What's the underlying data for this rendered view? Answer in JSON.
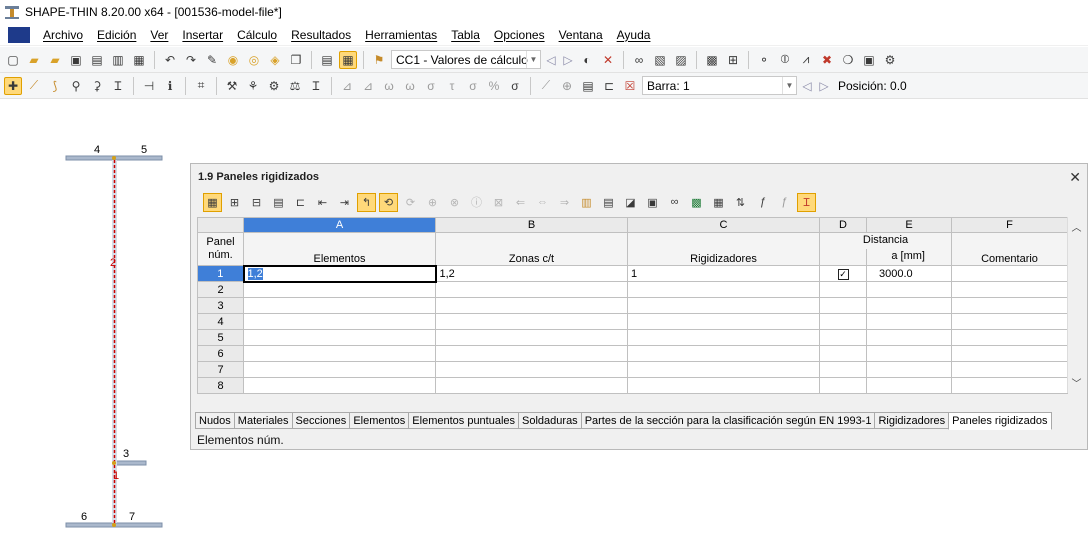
{
  "window": {
    "title": "SHAPE-THIN 8.20.00 x64 - [001536-model-file*]"
  },
  "menu": {
    "items": [
      "Archivo",
      "Edición",
      "Ver",
      "Insertar",
      "Cálculo",
      "Resultados",
      "Herramientas",
      "Tabla",
      "Opciones",
      "Ventana",
      "Ayuda"
    ]
  },
  "toolbar1": {
    "load_case": "CC1 - Valores de cálculo"
  },
  "toolbar2": {
    "bar_combo": "Barra: 1",
    "position": "Posición: 0.0"
  },
  "canvas": {
    "nodes": [
      "4",
      "5",
      "3",
      "6",
      "7"
    ],
    "elements": [
      "2",
      "1"
    ]
  },
  "panel": {
    "title": "1.9 Paneles rigidizados",
    "columns": [
      "A",
      "B",
      "C",
      "D",
      "E",
      "F"
    ],
    "header_group": "Distancia",
    "row_header_1": "Panel",
    "row_header_2": "núm.",
    "headers": {
      "elements": "Elementos",
      "zones": "Zonas c/t",
      "stiffeners": "Rigidizadores",
      "distance_unit": "a [mm]",
      "comment": "Comentario"
    },
    "rows": [
      {
        "num": "1",
        "elements": "1,2",
        "zones": "1,2",
        "stiffeners": "1",
        "checked": true,
        "distance": "3000.0",
        "comment": ""
      },
      {
        "num": "2",
        "elements": "",
        "zones": "",
        "stiffeners": "",
        "checked": false,
        "distance": "",
        "comment": ""
      },
      {
        "num": "3",
        "elements": "",
        "zones": "",
        "stiffeners": "",
        "checked": false,
        "distance": "",
        "comment": ""
      },
      {
        "num": "4",
        "elements": "",
        "zones": "",
        "stiffeners": "",
        "checked": false,
        "distance": "",
        "comment": ""
      },
      {
        "num": "5",
        "elements": "",
        "zones": "",
        "stiffeners": "",
        "checked": false,
        "distance": "",
        "comment": ""
      },
      {
        "num": "6",
        "elements": "",
        "zones": "",
        "stiffeners": "",
        "checked": false,
        "distance": "",
        "comment": ""
      },
      {
        "num": "7",
        "elements": "",
        "zones": "",
        "stiffeners": "",
        "checked": false,
        "distance": "",
        "comment": ""
      },
      {
        "num": "8",
        "elements": "",
        "zones": "",
        "stiffeners": "",
        "checked": false,
        "distance": "",
        "comment": ""
      }
    ],
    "tabs": [
      "Nudos",
      "Materiales",
      "Secciones",
      "Elementos",
      "Elementos puntuales",
      "Soldaduras",
      "Partes de la sección para la clasificación según EN 1993-1",
      "Rigidizadores",
      "Paneles rigidizados"
    ],
    "active_tab": "Paneles rigidizados",
    "status": "Elementos núm."
  },
  "colors": {
    "selection": "#3f7fd8",
    "active_button": "#ffd97a",
    "element_line": "#cc0000"
  }
}
